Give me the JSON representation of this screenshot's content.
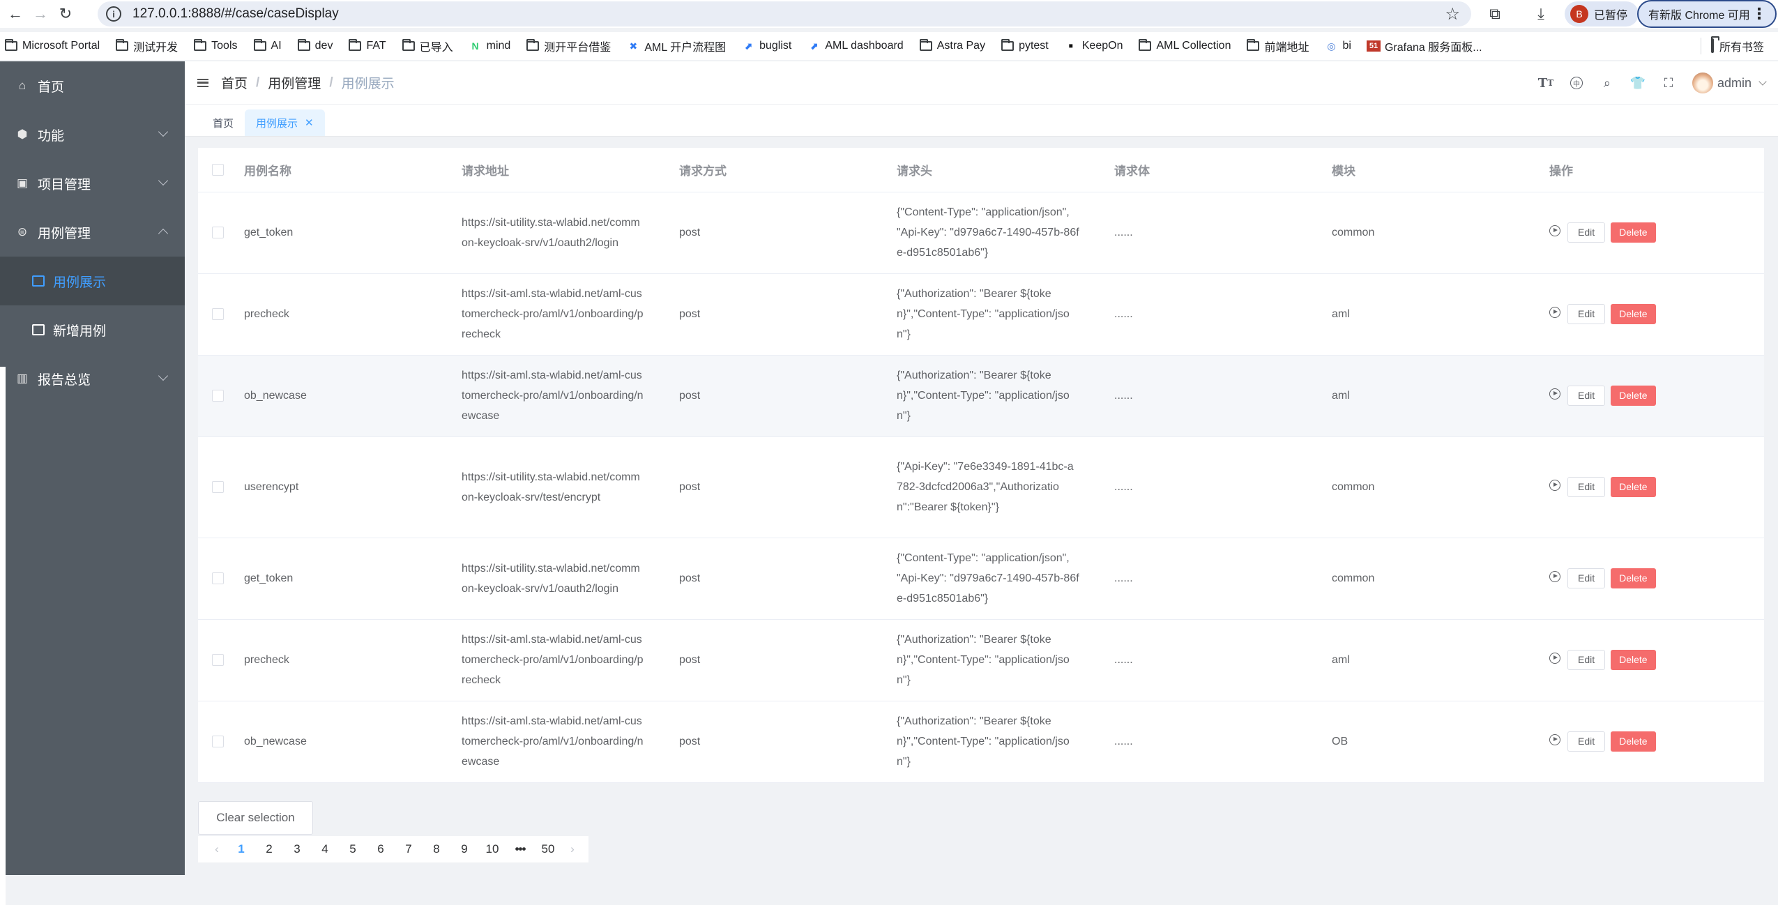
{
  "browser": {
    "url": "127.0.0.1:8888/#/case/caseDisplay",
    "profile_status": "已暂停",
    "profile_initial": "B",
    "update_label": "有新版 Chrome 可用",
    "bookmarks": [
      {
        "label": "Microsoft Portal",
        "icon": "portal-icon"
      },
      {
        "label": "测试开发",
        "icon": "folder-icon"
      },
      {
        "label": "Tools",
        "icon": "folder-icon"
      },
      {
        "label": "AI",
        "icon": "folder-icon"
      },
      {
        "label": "dev",
        "icon": "folder-icon"
      },
      {
        "label": "FAT",
        "icon": "folder-icon"
      },
      {
        "label": "已导入",
        "icon": "folder-icon"
      },
      {
        "label": "mind",
        "icon": "mind-icon"
      },
      {
        "label": "测开平台借鉴",
        "icon": "folder-icon"
      },
      {
        "label": "AML 开户流程图",
        "icon": "confluence-icon"
      },
      {
        "label": "buglist",
        "icon": "jira-icon"
      },
      {
        "label": "AML dashboard",
        "icon": "jira-icon"
      },
      {
        "label": "Astra Pay",
        "icon": "folder-icon"
      },
      {
        "label": "pytest",
        "icon": "folder-icon"
      },
      {
        "label": "KeepOn",
        "icon": "monitor-icon"
      },
      {
        "label": "AML Collection",
        "icon": "folder-icon"
      },
      {
        "label": "前端地址",
        "icon": "folder-icon"
      },
      {
        "label": "bi",
        "icon": "bi-icon"
      },
      {
        "label": "Grafana 服务面板...",
        "icon": "grafana-icon"
      }
    ],
    "all_bookmarks": "所有书签"
  },
  "sidebar": {
    "items": [
      {
        "label": "首页",
        "icon": "home-icon"
      },
      {
        "label": "功能",
        "icon": "cube-icon"
      },
      {
        "label": "项目管理",
        "icon": "code-box-icon"
      },
      {
        "label": "用例管理",
        "icon": "chat-icon"
      },
      {
        "label": "报告总览",
        "icon": "bar-chart-icon"
      }
    ],
    "sub_items": [
      {
        "label": "用例展示",
        "icon": "external-link-icon",
        "active": true
      },
      {
        "label": "新增用例",
        "icon": "external-link-icon",
        "active": false
      }
    ]
  },
  "header": {
    "breadcrumb": [
      "首页",
      "用例管理",
      "用例展示"
    ],
    "user": "admin"
  },
  "tabs": [
    {
      "label": "首页",
      "active": false
    },
    {
      "label": "用例展示",
      "active": true
    }
  ],
  "colors": {
    "accent": "#409eff",
    "danger": "#f56c6c",
    "sidebar_bg": "#545c64"
  },
  "table": {
    "columns": [
      "用例名称",
      "请求地址",
      "请求方式",
      "请求头",
      "请求体",
      "模块",
      "操作"
    ],
    "rows": [
      {
        "name": "get_token",
        "url": "https://sit-utility.sta-wlabid.net/common-keycloak-srv/v1/oauth2/login",
        "method": "post",
        "headers": "{\"Content-Type\": \"application/json\", \"Api-Key\": \"d979a6c7-1490-457b-86fe-d951c8501ab6\"}",
        "body": "......",
        "module": "common"
      },
      {
        "name": "precheck",
        "url": "https://sit-aml.sta-wlabid.net/aml-customercheck-pro/aml/v1/onboarding/precheck",
        "method": "post",
        "headers": "{\"Authorization\": \"Bearer ${token}\",\"Content-Type\": \"application/json\"}",
        "body": "......",
        "module": "aml"
      },
      {
        "name": "ob_newcase",
        "url": "https://sit-aml.sta-wlabid.net/aml-customercheck-pro/aml/v1/onboarding/newcase",
        "method": "post",
        "headers": "{\"Authorization\": \"Bearer ${token}\",\"Content-Type\": \"application/json\"}",
        "body": "......",
        "module": "aml"
      },
      {
        "name": "userencypt",
        "url": "https://sit-utility.sta-wlabid.net/common-keycloak-srv/test/encrypt",
        "method": "post",
        "headers": "{\"Api-Key\": \"7e6e3349-1891-41bc-a782-3dcfcd2006a3\",\"Authorization\":\"Bearer ${token}\"}",
        "body": "......",
        "module": "common"
      },
      {
        "name": "get_token",
        "url": "https://sit-utility.sta-wlabid.net/common-keycloak-srv/v1/oauth2/login",
        "method": "post",
        "headers": "{\"Content-Type\": \"application/json\", \"Api-Key\": \"d979a6c7-1490-457b-86fe-d951c8501ab6\"}",
        "body": "......",
        "module": "common"
      },
      {
        "name": "precheck",
        "url": "https://sit-aml.sta-wlabid.net/aml-customercheck-pro/aml/v1/onboarding/precheck",
        "method": "post",
        "headers": "{\"Authorization\": \"Bearer ${token}\",\"Content-Type\": \"application/json\"}",
        "body": "......",
        "module": "aml"
      },
      {
        "name": "ob_newcase",
        "url": "https://sit-aml.sta-wlabid.net/aml-customercheck-pro/aml/v1/onboarding/newcase",
        "method": "post",
        "headers": "{\"Authorization\": \"Bearer ${token}\",\"Content-Type\": \"application/json\"}",
        "body": "......",
        "module": "OB"
      }
    ],
    "actions": {
      "edit": "Edit",
      "delete": "Delete"
    }
  },
  "footer": {
    "clear_selection": "Clear selection",
    "pages": [
      "1",
      "2",
      "3",
      "4",
      "5",
      "6",
      "7",
      "8",
      "9",
      "10",
      "•••",
      "50"
    ],
    "current_page": "1"
  }
}
